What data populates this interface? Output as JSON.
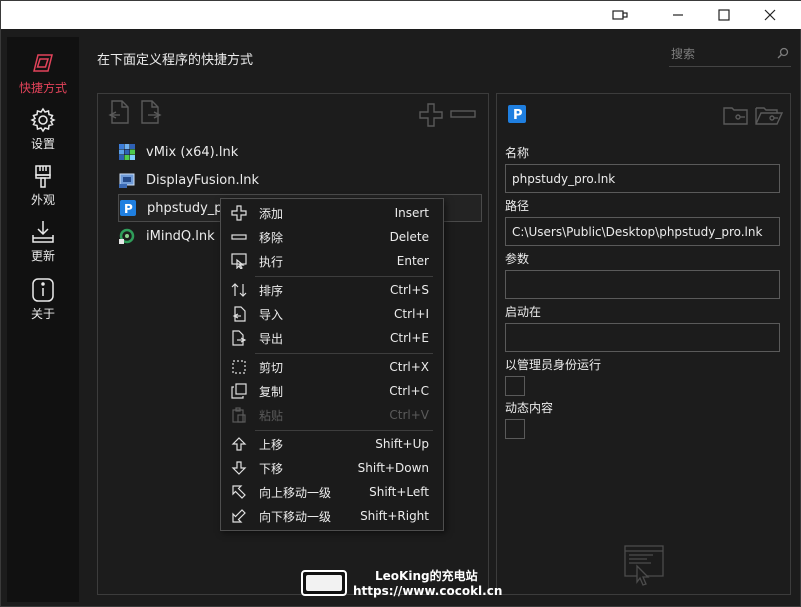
{
  "titlebar": {
    "icons": [
      "snap-icon",
      "minimize-icon",
      "maximize-icon",
      "close-icon"
    ]
  },
  "sidebar": {
    "items": [
      {
        "label": "快捷方式",
        "icon": "shortcut-icon",
        "active": true
      },
      {
        "label": "设置",
        "icon": "gear-icon",
        "active": false
      },
      {
        "label": "外观",
        "icon": "brush-icon",
        "active": false
      },
      {
        "label": "更新",
        "icon": "download-icon",
        "active": false
      },
      {
        "label": "关于",
        "icon": "info-icon",
        "active": false
      }
    ],
    "accent": "#e2435a"
  },
  "header": {
    "title": "在下面定义程序的快捷方式",
    "search_placeholder": "搜索"
  },
  "list": {
    "items": [
      {
        "name": "vMix (x64).lnk",
        "icon": "vmix-icon"
      },
      {
        "name": "DisplayFusion.lnk",
        "icon": "displayfusion-icon"
      },
      {
        "name": "phpstudy_pro.lnk",
        "icon": "phpstudy-icon",
        "selected": true
      },
      {
        "name": "iMindQ.lnk",
        "icon": "imindq-icon"
      }
    ]
  },
  "details": {
    "name_label": "名称",
    "name_value": "phpstudy_pro.lnk",
    "path_label": "路径",
    "path_value": "C:\\Users\\Public\\Desktop\\phpstudy_pro.lnk",
    "args_label": "参数",
    "args_value": "",
    "startin_label": "启动在",
    "startin_value": "",
    "admin_label": "以管理员身份运行",
    "dynamic_label": "动态内容"
  },
  "context_menu": {
    "items": [
      {
        "label": "添加",
        "shortcut": "Insert",
        "icon": "plus-icon"
      },
      {
        "label": "移除",
        "shortcut": "Delete",
        "icon": "minus-icon"
      },
      {
        "label": "执行",
        "shortcut": "Enter",
        "icon": "run-icon"
      },
      {
        "label": "排序",
        "shortcut": "Ctrl+S",
        "icon": "sort-icon"
      },
      {
        "label": "导入",
        "shortcut": "Ctrl+I",
        "icon": "import-icon"
      },
      {
        "label": "导出",
        "shortcut": "Ctrl+E",
        "icon": "export-icon"
      },
      {
        "label": "剪切",
        "shortcut": "Ctrl+X",
        "icon": "cut-icon"
      },
      {
        "label": "复制",
        "shortcut": "Ctrl+C",
        "icon": "copy-icon"
      },
      {
        "label": "粘贴",
        "shortcut": "Ctrl+V",
        "icon": "paste-icon",
        "disabled": true
      },
      {
        "label": "上移",
        "shortcut": "Shift+Up",
        "icon": "arrow-up-icon"
      },
      {
        "label": "下移",
        "shortcut": "Shift+Down",
        "icon": "arrow-down-icon"
      },
      {
        "label": "向上移动一级",
        "shortcut": "Shift+Left",
        "icon": "arrow-up-left-icon"
      },
      {
        "label": "向下移动一级",
        "shortcut": "Shift+Right",
        "icon": "arrow-down-left-icon"
      }
    ]
  },
  "watermark": {
    "line1": "LeoKing的充电站",
    "line2": "https://www.cocokl.cn"
  }
}
